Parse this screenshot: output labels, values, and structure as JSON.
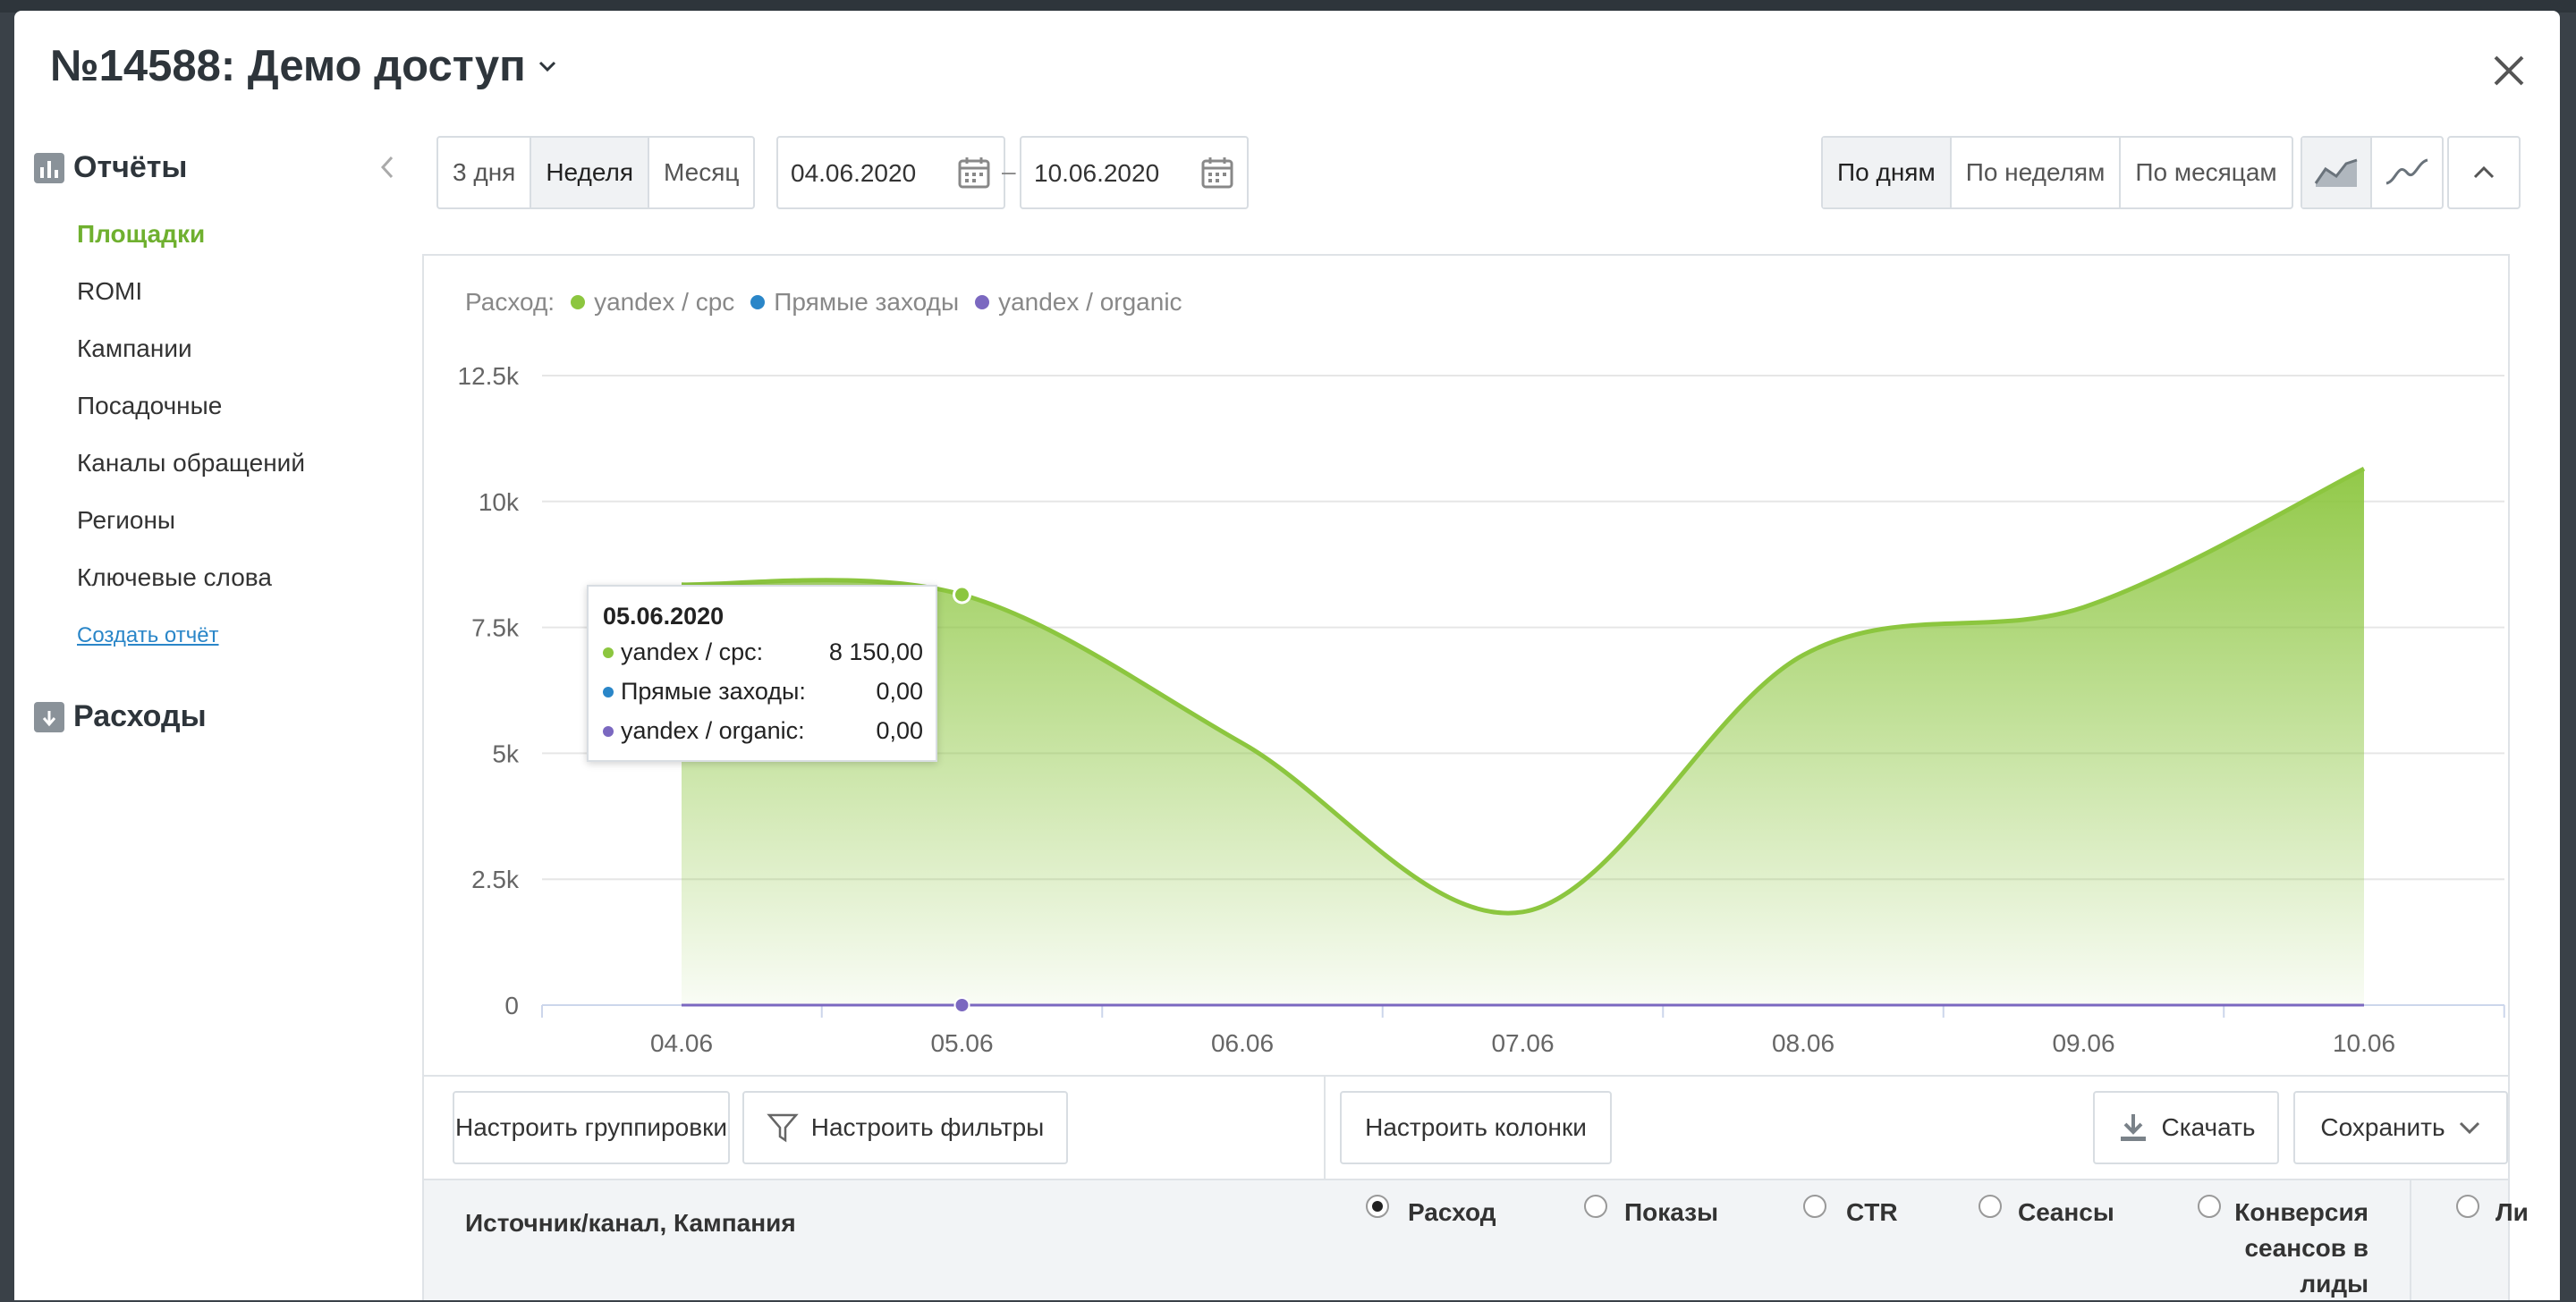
{
  "modal": {
    "title": "№14588: Демо доступ"
  },
  "sidebar": {
    "reports_title": "Отчёты",
    "items": [
      {
        "label": "Площадки",
        "active": true
      },
      {
        "label": "ROMI"
      },
      {
        "label": "Кампании"
      },
      {
        "label": "Посадочные"
      },
      {
        "label": "Каналы обращений"
      },
      {
        "label": "Регионы"
      },
      {
        "label": "Ключевые слова"
      }
    ],
    "create_report": "Создать отчёт",
    "expenses_title": "Расходы"
  },
  "toolbar": {
    "periods": [
      "3 дня",
      "Неделя",
      "Месяц"
    ],
    "selected_period": "Неделя",
    "date_from": "04.06.2020",
    "date_to": "10.06.2020",
    "group_by": [
      "По дням",
      "По неделям",
      "По месяцам"
    ],
    "selected_group": "По дням"
  },
  "chart_data": {
    "type": "area",
    "legend_label": "Расход:",
    "legend_position": "top-left",
    "categories": [
      "04.06",
      "05.06",
      "06.06",
      "07.06",
      "08.06",
      "09.06",
      "10.06"
    ],
    "series": [
      {
        "name": "yandex / cpc",
        "color": "#8cc63f",
        "values": [
          8350,
          8150,
          5200,
          1850,
          6950,
          7900,
          10650
        ]
      },
      {
        "name": "Прямые заходы",
        "color": "#2a86c8",
        "values": [
          0,
          0,
          0,
          0,
          0,
          0,
          0
        ]
      },
      {
        "name": "yandex / organic",
        "color": "#7b68c0",
        "values": [
          0,
          0,
          0,
          0,
          0,
          0,
          0
        ]
      }
    ],
    "y_ticks": [
      "0",
      "2.5k",
      "5k",
      "7.5k",
      "10k",
      "12.5k"
    ],
    "ylim": [
      0,
      12500
    ],
    "grid": true
  },
  "tooltip": {
    "date": "05.06.2020",
    "rows": [
      {
        "label": "yandex / cpc:",
        "value": "8 150,00",
        "color": "#8cc63f"
      },
      {
        "label": "Прямые заходы:",
        "value": "0,00",
        "color": "#2a86c8"
      },
      {
        "label": "yandex / organic:",
        "value": "0,00",
        "color": "#7b68c0"
      }
    ]
  },
  "actions": {
    "groupings": "Настроить группировки",
    "filters": "Настроить фильтры",
    "columns": "Настроить колонки",
    "download": "Скачать",
    "save": "Сохранить"
  },
  "table": {
    "first_column": "Источник/канал, Кампания",
    "metrics": [
      {
        "label": "Расход",
        "checked": true
      },
      {
        "label": "Показы"
      },
      {
        "label": "CTR"
      },
      {
        "label": "Сеансы"
      },
      {
        "label": "Конверсия сеансов в лиды"
      },
      {
        "label": "Ли"
      }
    ]
  }
}
